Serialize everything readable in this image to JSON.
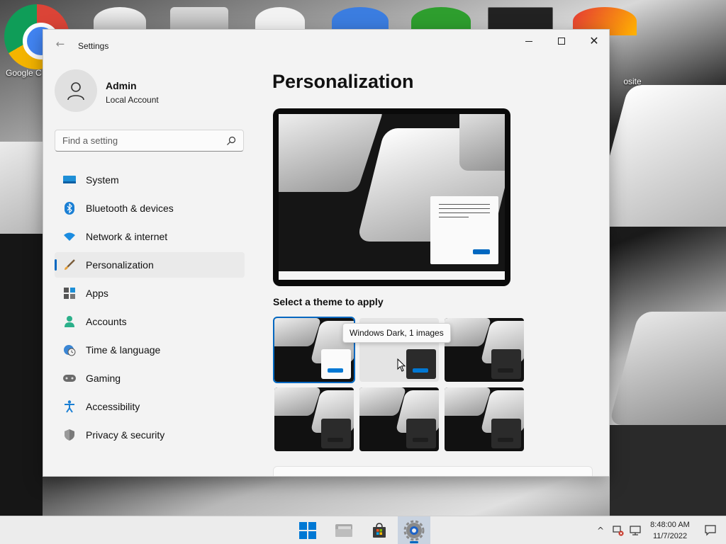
{
  "desktop": {
    "icons": [
      {
        "label": "Google C"
      },
      {
        "label": "osite"
      }
    ]
  },
  "window": {
    "app_title": "Settings",
    "back_glyph": "←",
    "minimize_glyph": "—",
    "close_glyph": "✕"
  },
  "profile": {
    "name": "Admin",
    "account_type": "Local Account"
  },
  "search": {
    "placeholder": "Find a setting",
    "value": ""
  },
  "nav": {
    "items": [
      {
        "label": "System",
        "icon": "monitor-icon",
        "selected": false
      },
      {
        "label": "Bluetooth & devices",
        "icon": "bluetooth-icon",
        "selected": false
      },
      {
        "label": "Network & internet",
        "icon": "wifi-icon",
        "selected": false
      },
      {
        "label": "Personalization",
        "icon": "paintbrush-icon",
        "selected": true
      },
      {
        "label": "Apps",
        "icon": "apps-icon",
        "selected": false
      },
      {
        "label": "Accounts",
        "icon": "person-icon",
        "selected": false
      },
      {
        "label": "Time & language",
        "icon": "globe-clock-icon",
        "selected": false
      },
      {
        "label": "Gaming",
        "icon": "gamepad-icon",
        "selected": false
      },
      {
        "label": "Accessibility",
        "icon": "accessibility-icon",
        "selected": false
      },
      {
        "label": "Privacy & security",
        "icon": "shield-icon",
        "selected": false
      }
    ]
  },
  "main": {
    "title": "Personalization",
    "theme_section_label": "Select a theme to apply",
    "tooltip": "Windows Dark, 1 images",
    "themes": [
      {
        "variant": "light-window",
        "selected": true
      },
      {
        "variant": "light-bg-dark-window",
        "selected": false
      },
      {
        "variant": "dark",
        "selected": false
      },
      {
        "variant": "dark",
        "selected": false
      },
      {
        "variant": "dark",
        "selected": false
      },
      {
        "variant": "dark",
        "selected": false
      }
    ]
  },
  "taskbar": {
    "apps": [
      {
        "name": "start-button"
      },
      {
        "name": "file-explorer"
      },
      {
        "name": "microsoft-store"
      },
      {
        "name": "settings",
        "active": true
      }
    ],
    "tray_chevron": "^",
    "clock_time": "8:48:00 AM",
    "clock_date": "11/7/2022"
  },
  "colors": {
    "accent": "#0067c0",
    "window_bg": "#f3f3f3",
    "taskbar_bg": "#ececec"
  }
}
